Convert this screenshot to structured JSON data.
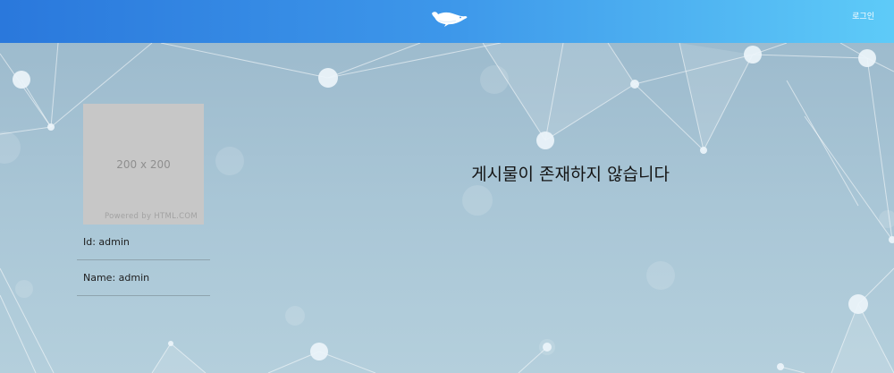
{
  "header": {
    "logo_icon": "whale-icon",
    "login_label": "로그인",
    "gradient_start": "#2a78dc",
    "gradient_end": "#5ecbf8"
  },
  "profile": {
    "avatar": {
      "size_label": "200 x 200",
      "powered_label": "Powered by HTML.COM"
    },
    "id_text": "Id: admin",
    "name_text": "Name: admin"
  },
  "main": {
    "empty_message": "게시물이 존재하지 않습니다"
  },
  "background": {
    "color": "#a9c6d6"
  }
}
